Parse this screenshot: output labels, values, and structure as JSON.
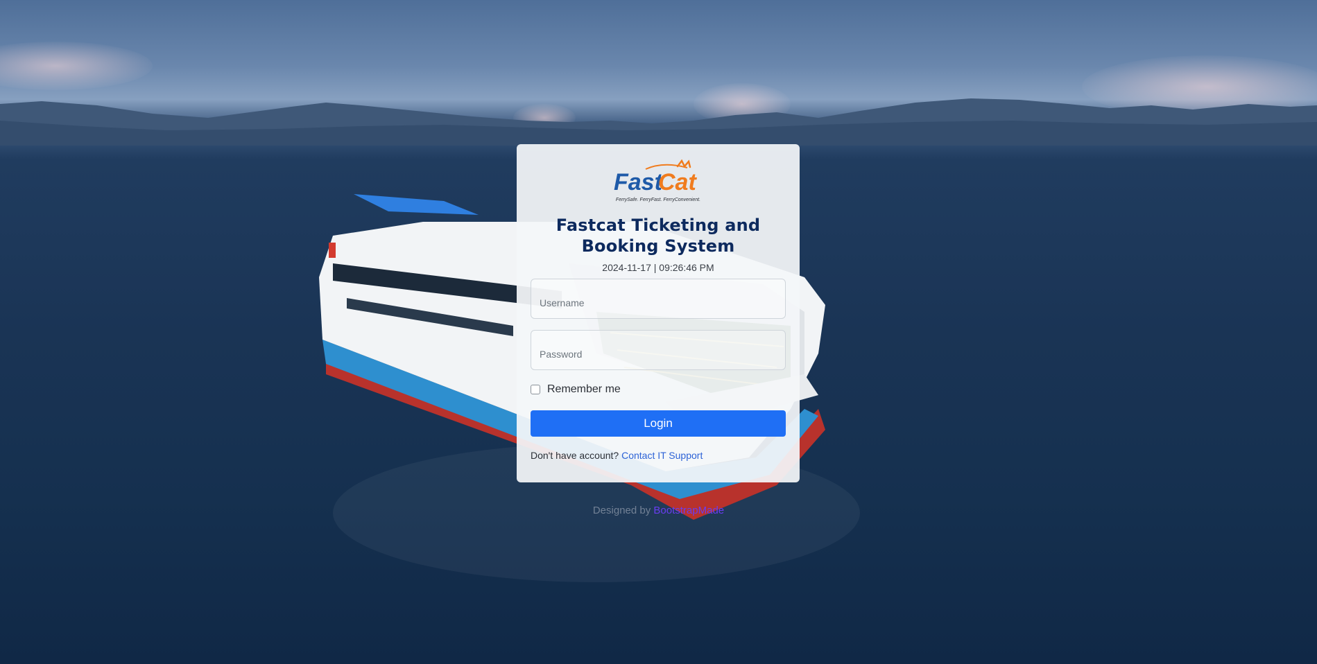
{
  "brand": {
    "logo_text_fast": "Fast",
    "logo_text_cat": "Cat",
    "tagline": "FerrySafe. FerryFast. FerryConvenient.",
    "colors": {
      "blue": "#1e5aa8",
      "orange": "#f07c1e"
    }
  },
  "login": {
    "title": "Fastcat Ticketing and Booking System",
    "datetime": "2024-11-17 | 09:26:46 PM",
    "username_placeholder": "Username",
    "password_placeholder": "Password",
    "remember_label": "Remember me",
    "login_label": "Login",
    "signup_prompt": "Don't have account?",
    "signup_link": "Contact IT Support"
  },
  "footer": {
    "prefix": "Designed by",
    "link": "BootstrapMade"
  },
  "colors": {
    "primary_button": "#1f6ff5",
    "title": "#0d2a5e",
    "link": "#2c62d6"
  }
}
